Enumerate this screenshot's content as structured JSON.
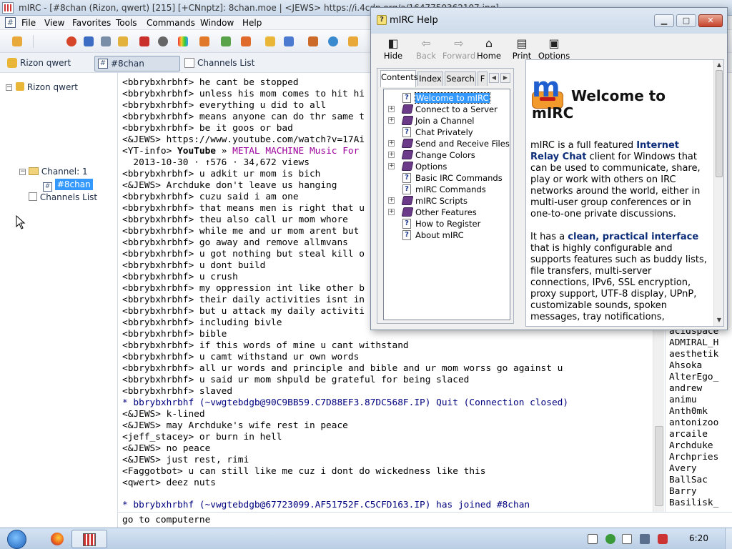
{
  "window": {
    "title": "mIRC - [#8chan (Rizon, qwert) [215] [+CNnptz]: 8chan.moe | <JEWS> https://i.4cdn.org/a/1647750362107.jpg]"
  },
  "menubar": [
    "File",
    "View",
    "Favorites",
    "Tools",
    "Commands",
    "Window",
    "Help"
  ],
  "switchbar": {
    "items": [
      {
        "label": "Rizon qwert",
        "icon": "server-icon"
      },
      {
        "label": "#8chan",
        "icon": "channel-icon",
        "active": true
      },
      {
        "label": "Channels List",
        "icon": "list-icon"
      }
    ]
  },
  "tree": {
    "server": "Rizon qwert",
    "folder": "Channel: 1",
    "channel": "#8chan",
    "channels_list": "Channels List"
  },
  "chat": {
    "lines": [
      {
        "text": "<bbrybxhrbhf> he cant be stopped"
      },
      {
        "text": "<bbrybxhrbhf> unless his mom comes to hit hi"
      },
      {
        "text": "<bbrybxhrbhf> everything u did to all"
      },
      {
        "text": "<bbrybxhrbhf> means anyone can do thr same t"
      },
      {
        "text": "<bbrybxhrbhf> be it goos or bad"
      },
      {
        "text": "<&JEWS> https://www.youtube.com/watch?v=17Ai"
      },
      {
        "text": "<YT-info> ",
        "yt_brand": "YouTube",
        "yt_sep": " » ",
        "yt_title": "METAL MACHINE Music For",
        "kind": "yt"
      },
      {
        "text": "  2013-10-30 · ↑576 · 34,672 views"
      },
      {
        "text": "<bbrybxhrbhf> u adkit ur mom is bich"
      },
      {
        "text": "<&JEWS> Archduke don't leave us hanging"
      },
      {
        "text": "<bbrybxhrbhf> cuzu said i am one"
      },
      {
        "text": "<bbrybxhrbhf> that means men is right that u"
      },
      {
        "text": "<bbrybxhrbhf> theu also call ur mom whore"
      },
      {
        "text": "<bbrybxhrbhf> while me and ur mom arent but"
      },
      {
        "text": "<bbrybxhrbhf> go away and remove allmvans"
      },
      {
        "text": "<bbrybxhrbhf> u got nothing but steal kill o"
      },
      {
        "text": "<bbrybxhrbhf> u dont build"
      },
      {
        "text": "<bbrybxhrbhf> u crush"
      },
      {
        "text": "<bbrybxhrbhf> my oppression int like other b"
      },
      {
        "text": "<bbrybxhrbhf> their daily activities isnt in"
      },
      {
        "text": "<bbrybxhrbhf> but u attack my daily activiti"
      },
      {
        "text": "<bbrybxhrbhf> including bivle"
      },
      {
        "text": "<bbrybxhrbhf> bible"
      },
      {
        "text": "<bbrybxhrbhf> if this words of mine u cant withstand"
      },
      {
        "text": "<bbrybxhrbhf> u camt withstand ur own words"
      },
      {
        "text": "<bbrybxhrbhf> all ur words and principle and bible and ur mom worss go against u"
      },
      {
        "text": "<bbrybxhrbhf> u said ur mom shpuld be grateful for being slaced"
      },
      {
        "text": "<bbrybxhrbhf> slaved"
      },
      {
        "text": "* bbrybxhrbhf (~vwgtebdgb@90C9BB59.C7D88EF3.87DC568F.IP) Quit (Connection closed)",
        "kind": "quit"
      },
      {
        "text": "<&JEWS> k-lined"
      },
      {
        "text": "<&JEWS> may Archduke's wife rest in peace"
      },
      {
        "text": "<jeff_stacey> or burn in hell"
      },
      {
        "text": "<&JEWS> no peace"
      },
      {
        "text": "<&JEWS> just rest, rimi"
      },
      {
        "text": "<Faggotbot> u can still like me cuz i dont do wickedness like this"
      },
      {
        "text": "<qwert> deez nuts"
      }
    ],
    "join_line": "* bbrybxhrbhf (~vwgtebdgb@67723099.AF51752F.C5CFD163.IP) has joined #8chan"
  },
  "nicklist": [
    "acidspace",
    "ADMIRAL_H",
    "aesthetik",
    "Ahsoka",
    "AlterEgo_",
    "andrew",
    "animu",
    "Anth0mk",
    "antonizoo",
    "arcaile",
    "Archduke",
    "Archpries",
    "Avery",
    "BallSac",
    "Barry",
    "Basilisk_"
  ],
  "editbox": {
    "value": "go to computerne"
  },
  "help": {
    "title": "mIRC Help",
    "toolbar": [
      {
        "label": "Hide",
        "icon": "hide-icon",
        "disabled": false
      },
      {
        "label": "Back",
        "icon": "back-arrow-icon",
        "disabled": true
      },
      {
        "label": "Forward",
        "icon": "forward-arrow-icon",
        "disabled": true
      },
      {
        "label": "Home",
        "icon": "home-icon",
        "disabled": false
      },
      {
        "label": "Print",
        "icon": "print-icon",
        "disabled": false
      },
      {
        "label": "Options",
        "icon": "options-icon",
        "disabled": false
      }
    ],
    "tabs": [
      "Contents",
      "Index",
      "Search",
      "F"
    ],
    "contents": [
      {
        "label": "Welcome to mIRC",
        "type": "page",
        "selected": true
      },
      {
        "label": "Connect to a Server",
        "type": "book"
      },
      {
        "label": "Join a Channel",
        "type": "book"
      },
      {
        "label": "Chat Privately",
        "type": "page"
      },
      {
        "label": "Send and Receive Files",
        "type": "book"
      },
      {
        "label": "Change Colors",
        "type": "book"
      },
      {
        "label": "Options",
        "type": "book"
      },
      {
        "label": "Basic IRC Commands",
        "type": "page"
      },
      {
        "label": "mIRC Commands",
        "type": "page"
      },
      {
        "label": "mIRC Scripts",
        "type": "book"
      },
      {
        "label": "Other Features",
        "type": "book"
      },
      {
        "label": "How to Register",
        "type": "page"
      },
      {
        "label": "About mIRC",
        "type": "page"
      }
    ],
    "article": {
      "heading_1": "Welcome to",
      "heading_2": "mIRC",
      "p1_a": "mIRC is a full featured ",
      "p1_b": "Internet Relay Chat",
      "p1_c": " client for Windows that can be used to communicate, share, play or work with others on IRC networks around the world, either in multi-user group conferences or in one-to-one private discussions.",
      "p2_a": "It has a ",
      "p2_b": "clean, practical interface",
      "p2_c": " that is highly configurable and supports features such as buddy lists, file transfers, multi-server connections, IPv6, SSL encryption, proxy support, UTF-8 display, UPnP, customizable sounds, spoken messages, tray notifications,"
    }
  },
  "taskbar": {
    "clock": "6:20",
    "apps": [
      "firefox-icon",
      "mirc-icon"
    ]
  }
}
